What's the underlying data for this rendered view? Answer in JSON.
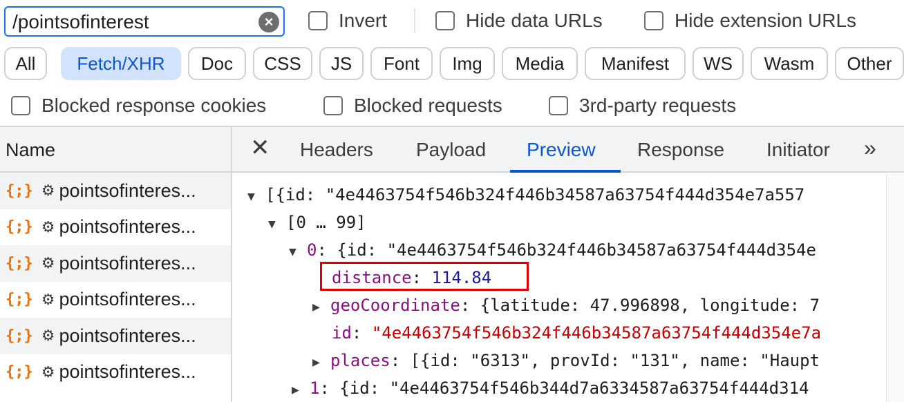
{
  "filter": {
    "value": "/pointsofinterest",
    "clear_label": "×"
  },
  "checkboxes_top": [
    "Invert",
    "Hide data URLs",
    "Hide extension URLs"
  ],
  "type_filters": [
    "All",
    "Fetch/XHR",
    "Doc",
    "CSS",
    "JS",
    "Font",
    "Img",
    "Media",
    "Manifest",
    "WS",
    "Wasm",
    "Other"
  ],
  "active_type": "Fetch/XHR",
  "checkboxes_bottom": [
    "Blocked response cookies",
    "Blocked requests",
    "3rd-party requests"
  ],
  "name_column": {
    "header": "Name",
    "rows": [
      "pointsofinteres...",
      "pointsofinteres...",
      "pointsofinteres...",
      "pointsofinteres...",
      "pointsofinteres...",
      "pointsofinteres..."
    ],
    "row_icon": "{;}",
    "gear": "⚙"
  },
  "tabs": {
    "close": "✕",
    "items": [
      "Headers",
      "Payload",
      "Preview",
      "Response",
      "Initiator"
    ],
    "active": "Preview",
    "more": "»"
  },
  "preview": {
    "line1": "[{id: \"4e4463754f546b324f446b34587a63754f444d354e7a557",
    "line2": "[0 … 99]",
    "line3_key": "0",
    "line3_rest": ": {id: \"4e4463754f546b324f446b34587a63754f444d354e",
    "distance_key": "distance",
    "distance_value": "114.84",
    "geo_key": "geoCoordinate",
    "geo_rest": ": {latitude: 47.996898, longitude: 7",
    "id_key": "id",
    "id_value": "\"4e4463754f546b324f446b34587a63754f444d354e7a",
    "places_key": "places",
    "places_rest": ": [{id: \"6313\", provId: \"131\", name: \"Haupt",
    "item1_key": "1",
    "item1_rest": ": {id: \"4e4463754f546b344d7a6334587a63754f444d314"
  }
}
